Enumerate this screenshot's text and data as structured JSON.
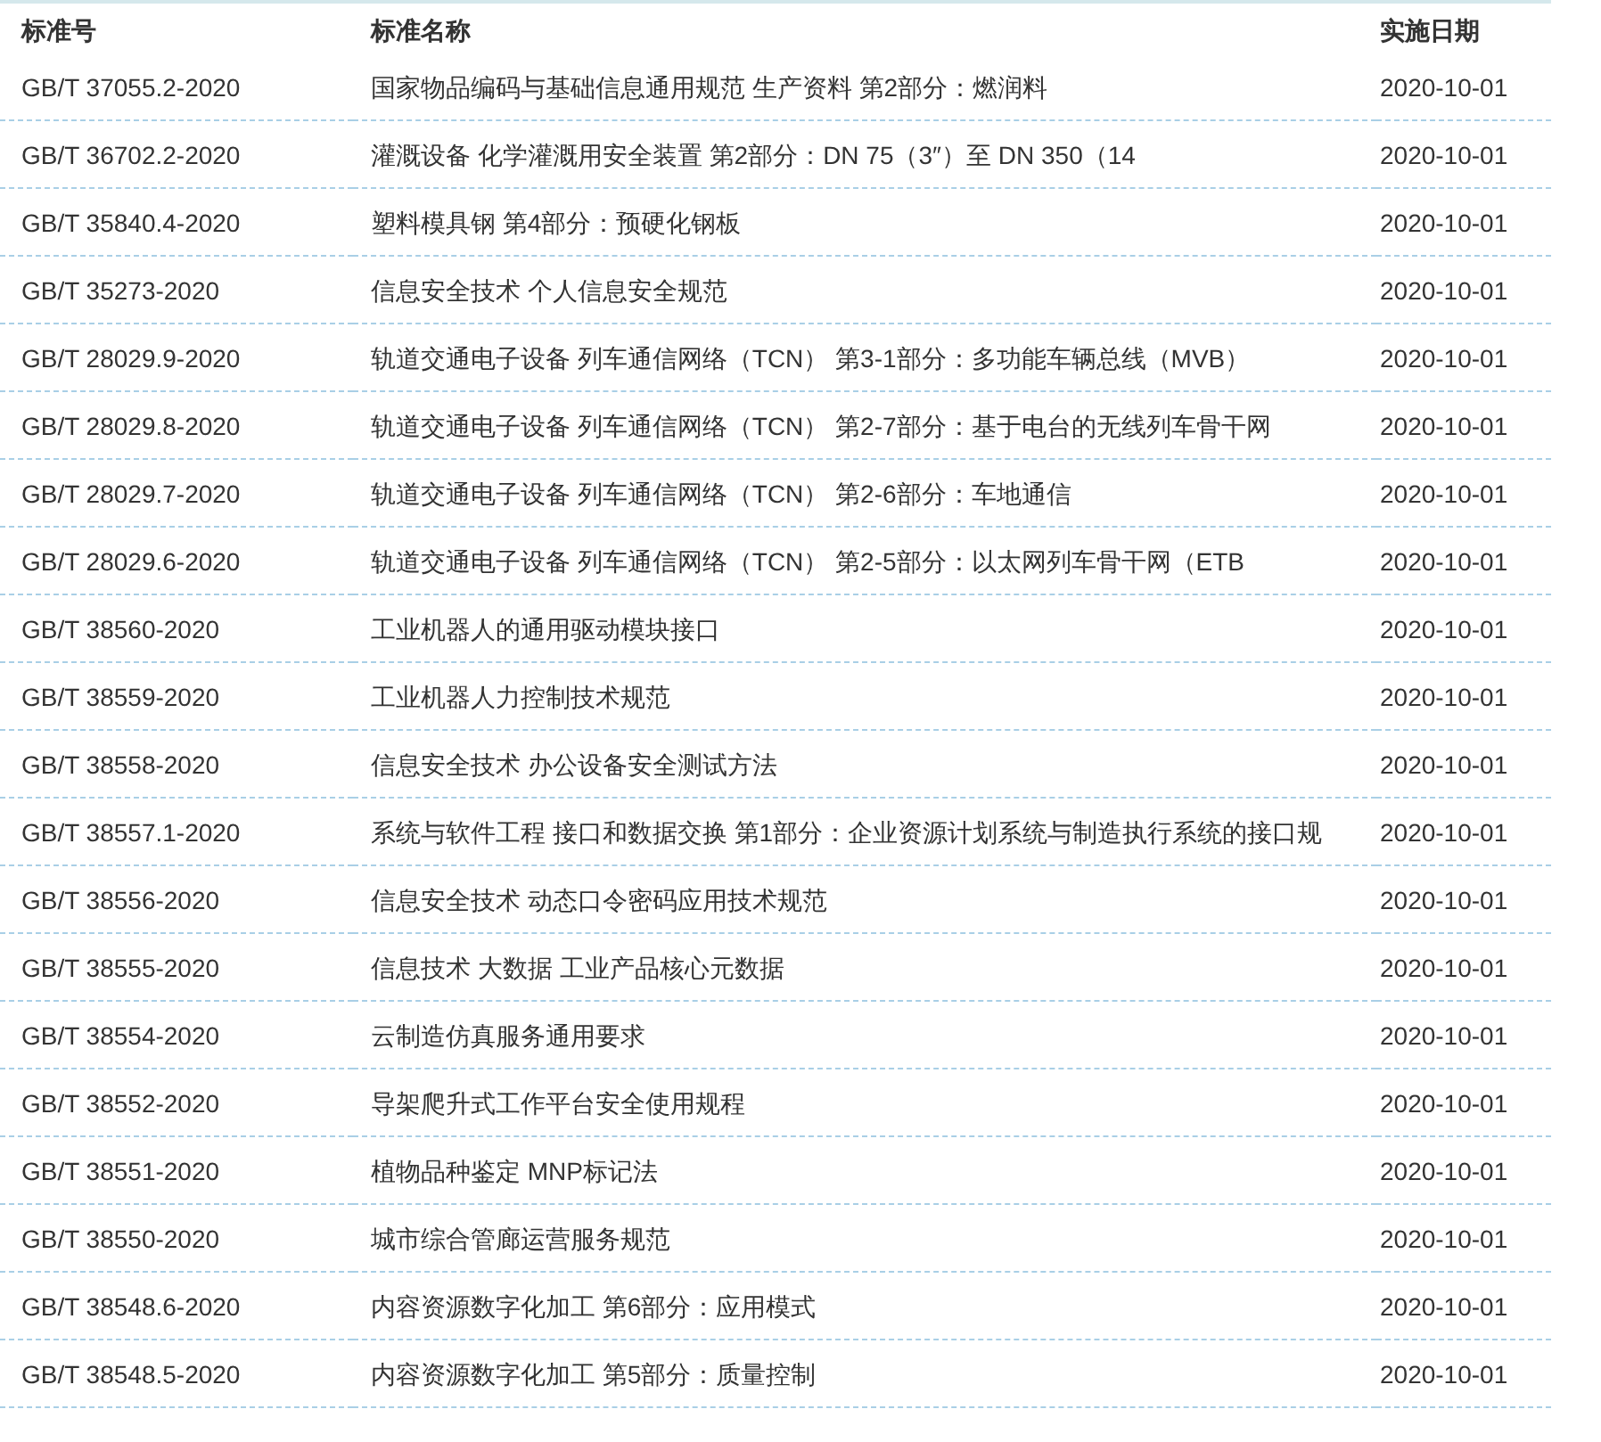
{
  "table": {
    "columns": [
      "标准号",
      "标准名称",
      "实施日期"
    ],
    "rows": [
      {
        "number": "GB/T 37055.2-2020",
        "name": "国家物品编码与基础信息通用规范 生产资料 第2部分：燃润料",
        "date": "2020-10-01"
      },
      {
        "number": "GB/T 36702.2-2020",
        "name": "灌溉设备 化学灌溉用安全装置 第2部分：DN 75（3″）至 DN 350（14",
        "date": "2020-10-01"
      },
      {
        "number": "GB/T 35840.4-2020",
        "name": "塑料模具钢 第4部分：预硬化钢板",
        "date": "2020-10-01"
      },
      {
        "number": "GB/T 35273-2020",
        "name": "信息安全技术 个人信息安全规范",
        "date": "2020-10-01"
      },
      {
        "number": "GB/T 28029.9-2020",
        "name": "轨道交通电子设备 列车通信网络（TCN） 第3-1部分：多功能车辆总线（MVB）",
        "date": "2020-10-01"
      },
      {
        "number": "GB/T 28029.8-2020",
        "name": "轨道交通电子设备 列车通信网络（TCN） 第2-7部分：基于电台的无线列车骨干网",
        "date": "2020-10-01"
      },
      {
        "number": "GB/T 28029.7-2020",
        "name": "轨道交通电子设备 列车通信网络（TCN） 第2-6部分：车地通信",
        "date": "2020-10-01"
      },
      {
        "number": "GB/T 28029.6-2020",
        "name": "轨道交通电子设备 列车通信网络（TCN） 第2-5部分：以太网列车骨干网（ETB",
        "date": "2020-10-01"
      },
      {
        "number": "GB/T 38560-2020",
        "name": "工业机器人的通用驱动模块接口",
        "date": "2020-10-01"
      },
      {
        "number": "GB/T 38559-2020",
        "name": "工业机器人力控制技术规范",
        "date": "2020-10-01"
      },
      {
        "number": "GB/T 38558-2020",
        "name": "信息安全技术 办公设备安全测试方法",
        "date": "2020-10-01"
      },
      {
        "number": "GB/T 38557.1-2020",
        "name": "系统与软件工程 接口和数据交换 第1部分：企业资源计划系统与制造执行系统的接口规",
        "date": "2020-10-01"
      },
      {
        "number": "GB/T 38556-2020",
        "name": "信息安全技术 动态口令密码应用技术规范",
        "date": "2020-10-01"
      },
      {
        "number": "GB/T 38555-2020",
        "name": "信息技术 大数据 工业产品核心元数据",
        "date": "2020-10-01"
      },
      {
        "number": "GB/T 38554-2020",
        "name": "云制造仿真服务通用要求",
        "date": "2020-10-01"
      },
      {
        "number": "GB/T 38552-2020",
        "name": "导架爬升式工作平台安全使用规程",
        "date": "2020-10-01"
      },
      {
        "number": "GB/T 38551-2020",
        "name": "植物品种鉴定 MNP标记法",
        "date": "2020-10-01"
      },
      {
        "number": "GB/T 38550-2020",
        "name": "城市综合管廊运营服务规范",
        "date": "2020-10-01"
      },
      {
        "number": "GB/T 38548.6-2020",
        "name": "内容资源数字化加工 第6部分：应用模式",
        "date": "2020-10-01"
      },
      {
        "number": "GB/T 38548.5-2020",
        "name": "内容资源数字化加工 第5部分：质量控制",
        "date": "2020-10-01"
      }
    ]
  }
}
